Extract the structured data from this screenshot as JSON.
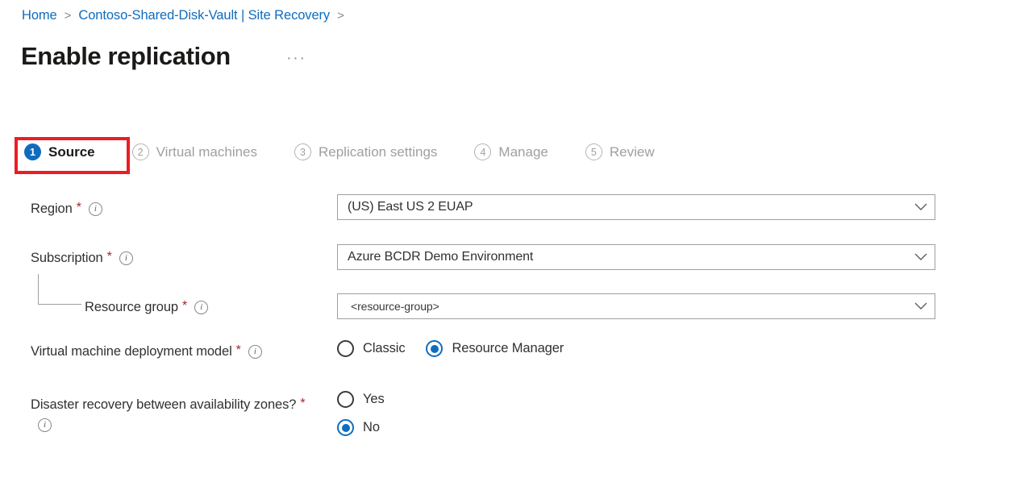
{
  "breadcrumb": {
    "items": [
      {
        "label": "Home"
      },
      {
        "label": "Contoso-Shared-Disk-Vault | Site Recovery"
      }
    ],
    "separator": ">"
  },
  "header": {
    "title": "Enable replication",
    "more_menu": "···"
  },
  "wizard": {
    "steps": [
      {
        "number": "1",
        "label": "Source",
        "state": "active"
      },
      {
        "number": "2",
        "label": "Virtual machines",
        "state": "inactive"
      },
      {
        "number": "3",
        "label": "Replication settings",
        "state": "inactive"
      },
      {
        "number": "4",
        "label": "Manage",
        "state": "inactive"
      },
      {
        "number": "5",
        "label": "Review",
        "state": "inactive"
      }
    ]
  },
  "annotation": {
    "color": "#ed1c24",
    "target": "Source"
  },
  "form": {
    "region": {
      "label": "Region",
      "required": "*",
      "info": "i",
      "value": "(US) East US 2 EUAP"
    },
    "subscription": {
      "label": "Subscription",
      "required": "*",
      "info": "i",
      "value": "Azure BCDR Demo Environment"
    },
    "resource_group": {
      "label": "Resource group",
      "required": "*",
      "info": "i",
      "value": "<resource-group>"
    },
    "deployment_model": {
      "label": "Virtual machine deployment model",
      "required": "*",
      "info": "i",
      "options": [
        {
          "label": "Classic",
          "selected": false
        },
        {
          "label": "Resource Manager",
          "selected": true
        }
      ]
    },
    "availability_zones": {
      "label": "Disaster recovery between availability zones?",
      "required": "*",
      "info": "i",
      "options": [
        {
          "label": "Yes",
          "selected": false
        },
        {
          "label": "No",
          "selected": true
        }
      ]
    }
  },
  "colors": {
    "accent": "#0f6cbd",
    "link": "#0f6cbd",
    "required": "#a4262c",
    "annotation": "#ed1c24"
  }
}
